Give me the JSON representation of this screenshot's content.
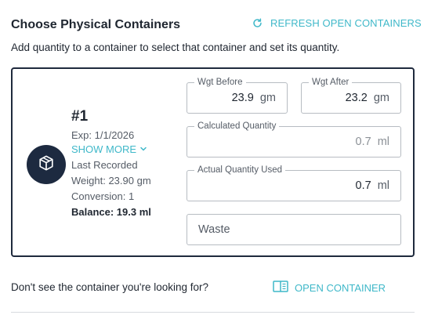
{
  "header": {
    "title": "Choose Physical Containers",
    "refresh_label": "REFRESH OPEN CONTAINERS",
    "subtitle": "Add quantity to a container to select that container and set its quantity."
  },
  "container": {
    "number": "#1",
    "exp": "Exp: 1/1/2026",
    "show_more_label": "SHOW MORE",
    "last_recorded": "Last Recorded",
    "weight": "Weight: 23.90 gm",
    "conversion": "Conversion: 1",
    "balance": "Balance: 19.3 ml",
    "icon": "box-icon"
  },
  "fields": {
    "wgt_before": {
      "label": "Wgt Before",
      "value": "23.9",
      "unit": "gm"
    },
    "wgt_after": {
      "label": "Wgt After",
      "value": "23.2",
      "unit": "gm"
    },
    "calculated_quantity": {
      "label": "Calculated Quantity",
      "value": "0.7",
      "unit": "ml"
    },
    "actual_quantity": {
      "label": "Actual Quantity Used",
      "value": "0.7",
      "unit": "ml"
    },
    "waste": {
      "placeholder": "Waste"
    }
  },
  "footer": {
    "question": "Don't see the container you're looking for?",
    "open_label": "OPEN CONTAINER"
  },
  "colors": {
    "accent": "#3fb8c9",
    "dark": "#1d2a40",
    "text": "#1f2630"
  }
}
